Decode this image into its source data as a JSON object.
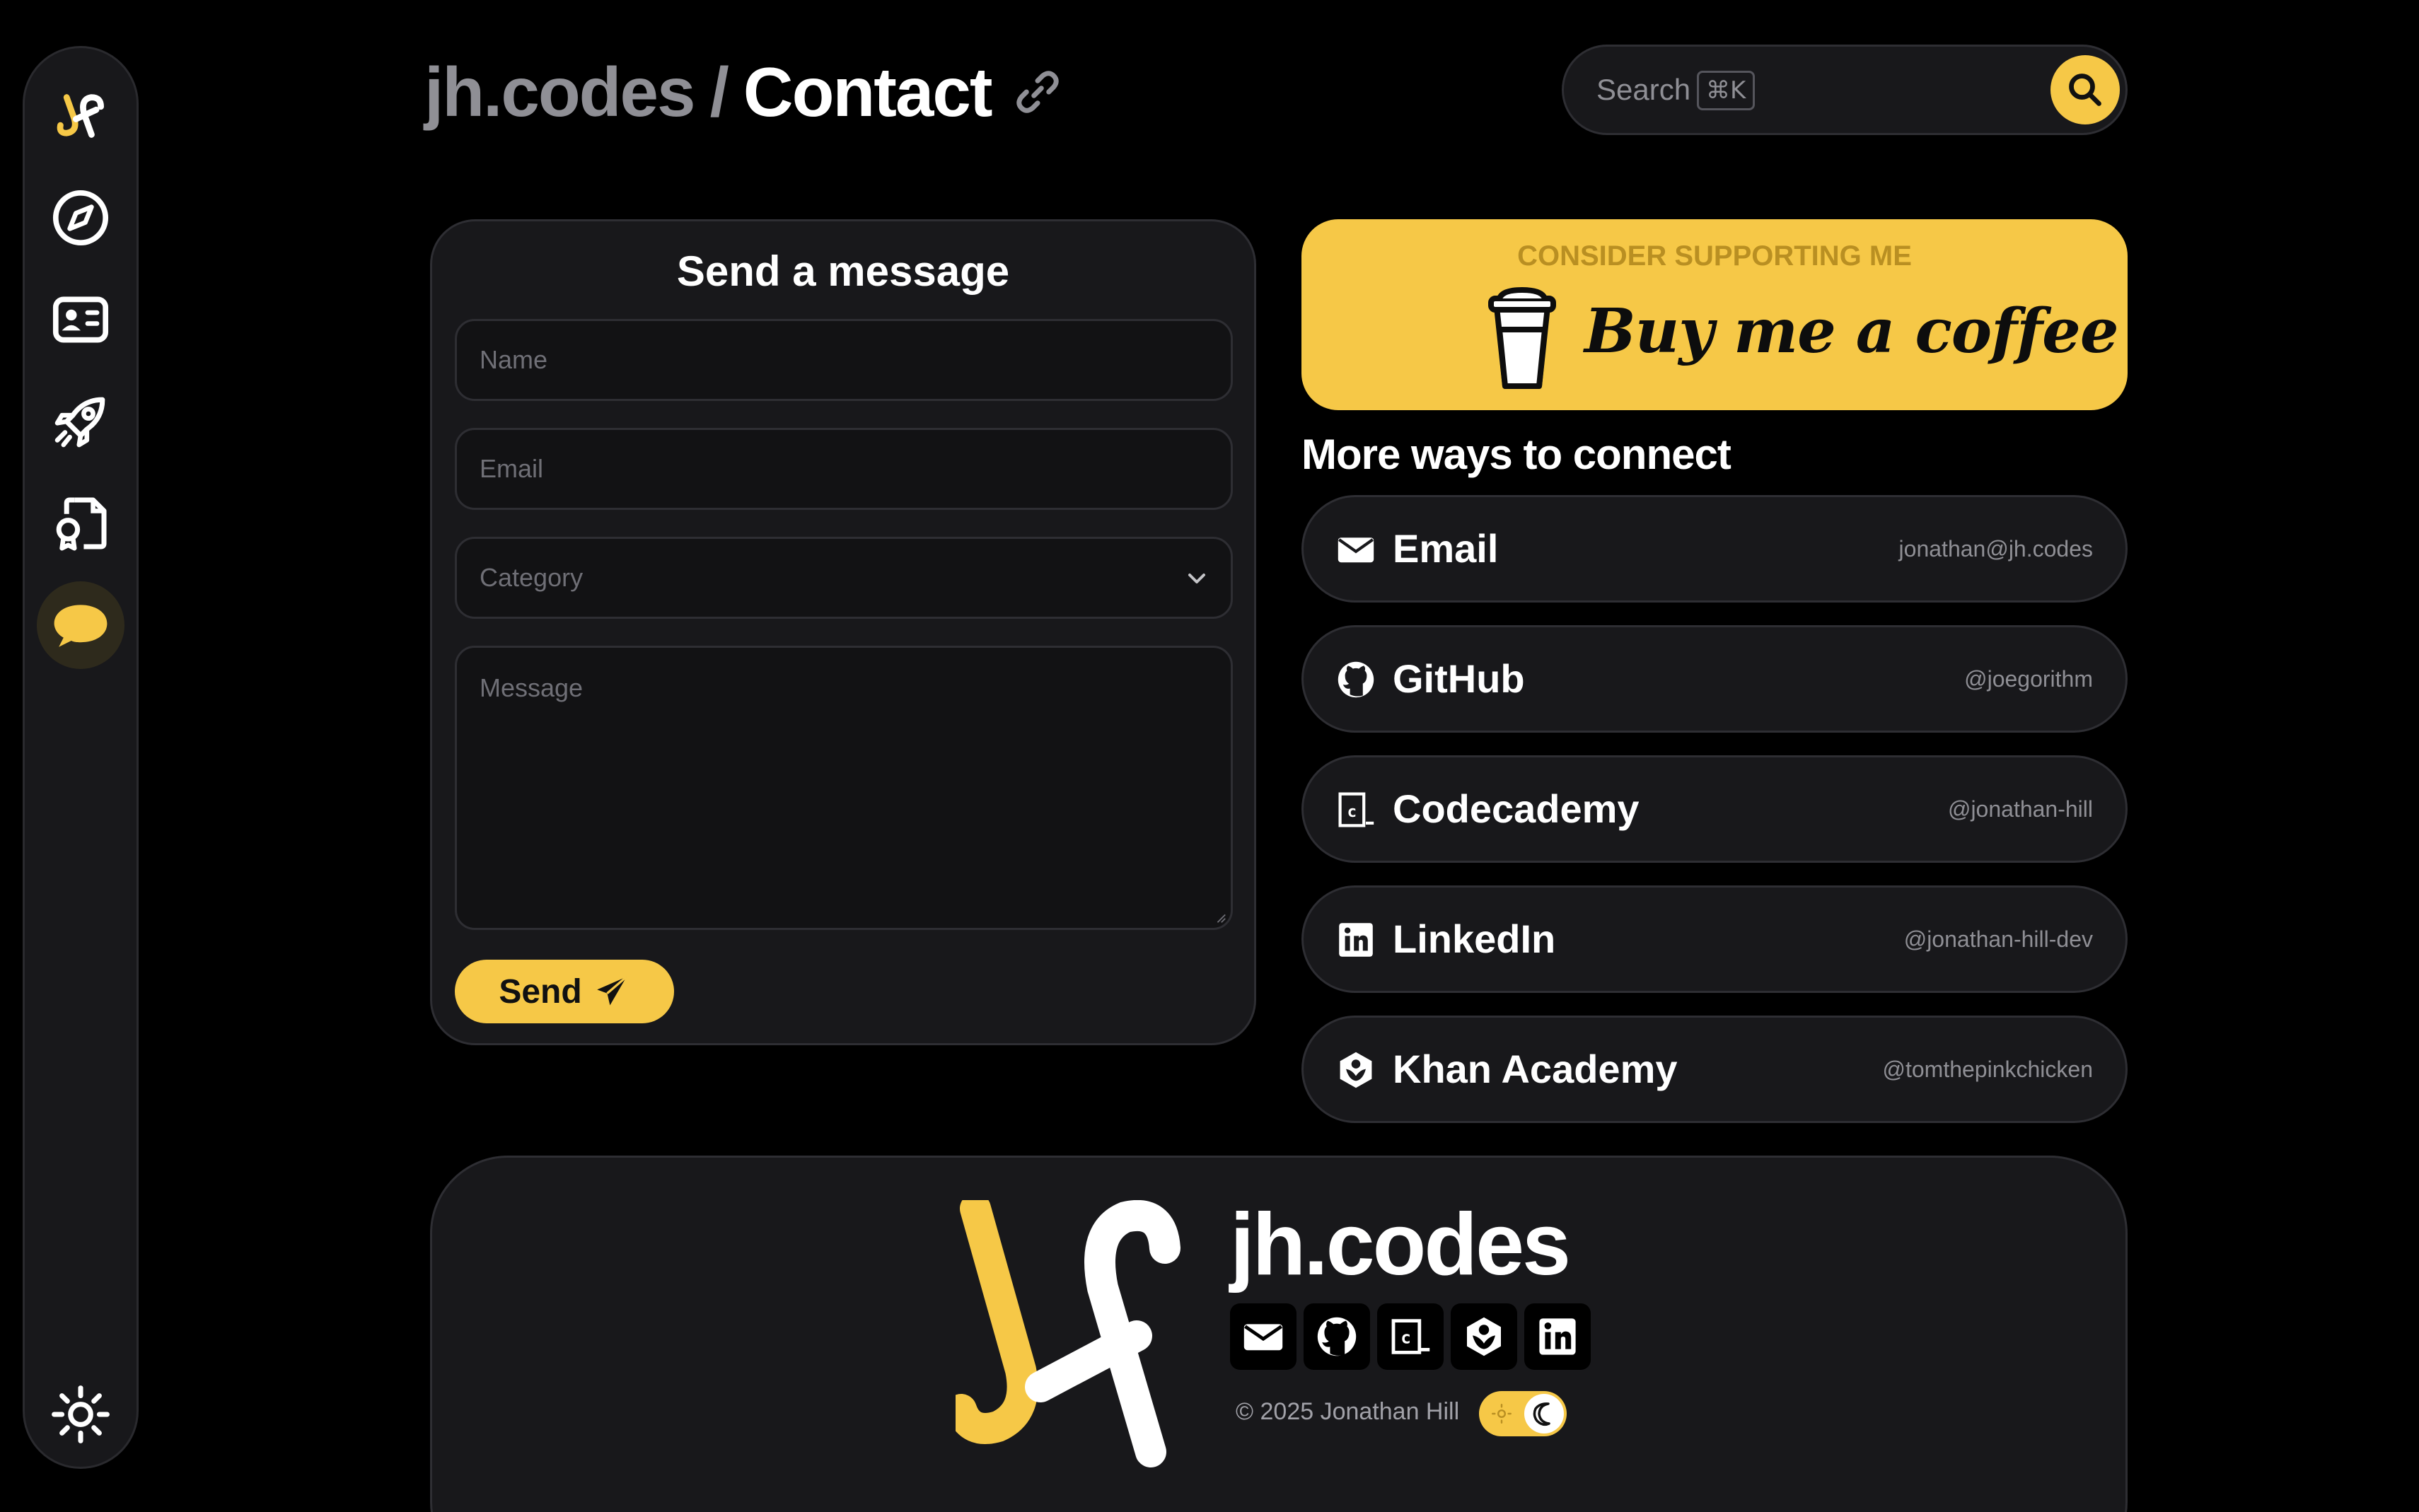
{
  "header": {
    "site": "jh.codes",
    "separator": "/",
    "page": "Contact",
    "link_icon": "link-icon"
  },
  "search": {
    "label": "Search",
    "shortcut": "⌘K",
    "button_icon": "search-icon"
  },
  "sidebar": {
    "items": [
      {
        "icon": "jh-logo-icon"
      },
      {
        "icon": "compass-icon"
      },
      {
        "icon": "id-card-icon"
      },
      {
        "icon": "rocket-icon"
      },
      {
        "icon": "certificate-file-icon"
      },
      {
        "icon": "chat-bubble-icon",
        "active": true
      }
    ],
    "theme_icon": "sun-icon"
  },
  "form": {
    "title": "Send a message",
    "name_placeholder": "Name",
    "email_placeholder": "Email",
    "category_placeholder": "Category",
    "message_placeholder": "Message",
    "send_label": "Send"
  },
  "support": {
    "caption": "CONSIDER SUPPORTING ME",
    "button_text": "Buy me a coffee"
  },
  "connect": {
    "title": "More ways to connect",
    "links": [
      {
        "name": "Email",
        "handle": "jonathan@jh.codes",
        "icon": "envelope-icon"
      },
      {
        "name": "GitHub",
        "handle": "@joegorithm",
        "icon": "github-icon"
      },
      {
        "name": "Codecademy",
        "handle": "@jonathan-hill",
        "icon": "codecademy-icon"
      },
      {
        "name": "LinkedIn",
        "handle": "@jonathan-hill-dev",
        "icon": "linkedin-icon"
      },
      {
        "name": "Khan Academy",
        "handle": "@tomthepinkchicken",
        "icon": "khan-academy-icon"
      }
    ]
  },
  "footer": {
    "site": "jh.codes",
    "copyright": "© 2025 Jonathan Hill",
    "social_icons": [
      "envelope-icon",
      "github-icon",
      "codecademy-icon",
      "khan-academy-icon",
      "linkedin-icon"
    ]
  },
  "colors": {
    "accent": "#f6c847",
    "background": "#000000",
    "surface": "#18181b",
    "muted_text": "#8f8f95"
  }
}
